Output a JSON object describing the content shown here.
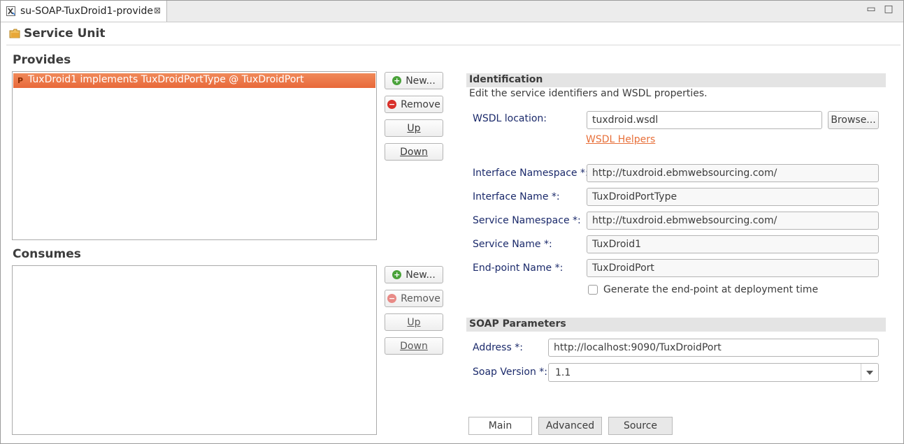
{
  "window": {
    "tab_title": "su-SOAP-TuxDroid1-provide",
    "tab_close": "⊠",
    "minimize": "▭",
    "maximize": "□"
  },
  "header": {
    "title": "Service Unit"
  },
  "provides": {
    "title": "Provides",
    "items": [
      {
        "marker": "P",
        "label": "TuxDroid1 implements TuxDroidPortType @ TuxDroidPort"
      }
    ],
    "buttons": {
      "new": "New...",
      "remove": "Remove",
      "up": "Up",
      "down": "Down"
    }
  },
  "consumes": {
    "title": "Consumes",
    "items": [],
    "buttons": {
      "new": "New...",
      "remove": "Remove",
      "up": "Up",
      "down": "Down"
    }
  },
  "identification": {
    "title": "Identification",
    "description": "Edit the service identifiers and WSDL properties.",
    "wsdl_location_label": "WSDL location:",
    "wsdl_location_value": "tuxdroid.wsdl",
    "browse_label": "Browse...",
    "wsdl_helpers_label": "WSDL Helpers",
    "interface_namespace_label": "Interface Namespace *:",
    "interface_namespace_value": "http://tuxdroid.ebmwebsourcing.com/",
    "interface_name_label": "Interface Name *:",
    "interface_name_value": "TuxDroidPortType",
    "service_namespace_label": "Service Namespace *:",
    "service_namespace_value": "http://tuxdroid.ebmwebsourcing.com/",
    "service_name_label": "Service Name *:",
    "service_name_value": "TuxDroid1",
    "endpoint_name_label": "End-point Name *:",
    "endpoint_name_value": "TuxDroidPort",
    "generate_endpoint_label": "Generate the end-point at deployment time",
    "generate_endpoint_checked": false
  },
  "soap": {
    "title": "SOAP Parameters",
    "address_label": "Address *:",
    "address_value": "http://localhost:9090/TuxDroidPort",
    "version_label": "Soap Version *:",
    "version_value": "1.1"
  },
  "bottom_tabs": [
    {
      "label": "Main",
      "active": true
    },
    {
      "label": "Advanced",
      "active": false
    },
    {
      "label": "Source",
      "active": false
    }
  ],
  "colors": {
    "selection": "#e8683a",
    "link": "#e8703a",
    "label": "#1b2a6b"
  }
}
